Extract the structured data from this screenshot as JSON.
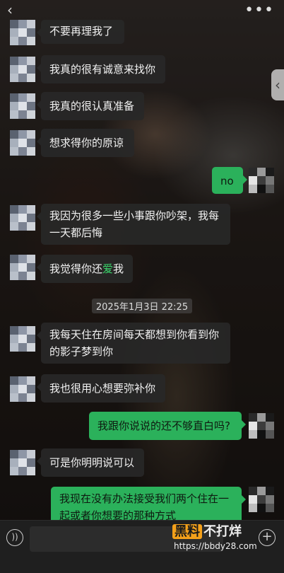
{
  "top_bar": {
    "back_icon": "chevron-left-icon",
    "more_icon": "more-horizontal-icon",
    "side_tab_icon": "chevron-left-icon"
  },
  "messages": [
    {
      "side": "in",
      "text": "不要再理我了"
    },
    {
      "side": "in",
      "text": "我真的很有诚意来找你"
    },
    {
      "side": "in",
      "text": "我真的很认真准备"
    },
    {
      "side": "in",
      "text": "想求得你的原谅"
    },
    {
      "side": "out",
      "text": "no"
    },
    {
      "side": "in",
      "text": "我因为很多一些小事跟你吵架，我每一天都后悔"
    },
    {
      "side": "in",
      "text_before": "我觉得你还",
      "text_highlight": "爱",
      "text_after": "我"
    },
    {
      "side": "in",
      "text": "我每天住在房间每天都想到你看到你的影子梦到你"
    },
    {
      "side": "in",
      "text": "我也很用心想要弥补你"
    },
    {
      "side": "out",
      "text": "我跟你说说的还不够直白吗?"
    },
    {
      "side": "in",
      "text": "可是你明明说可以"
    },
    {
      "side": "out",
      "text": "我现在没有办法接受我们两个住在一起或者你想要的那种方式"
    }
  ],
  "timestamp": "2025年1月3日 22:25",
  "input_bar": {
    "voice_icon": "voice-icon",
    "plus_icon": "plus-circle-icon"
  },
  "watermark": {
    "logo_part1": "黑料",
    "logo_part2": "不打烊",
    "url": "https://bbdy28.com"
  },
  "colors": {
    "outgoing_bubble": "#2bb15b",
    "incoming_bubble": "#282828",
    "highlight": "#39d36a"
  }
}
